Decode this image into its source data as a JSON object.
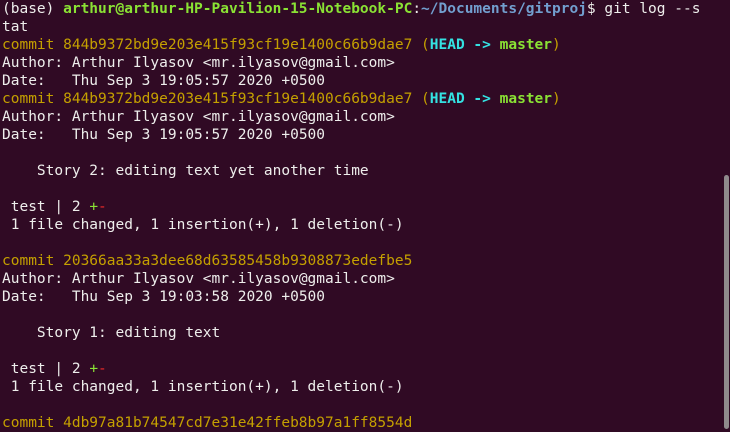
{
  "prompt": {
    "env": "(base) ",
    "user_host": "arthur@arthur-HP-Pavilion-15-Notebook-PC",
    "colon": ":",
    "path": "~/Documents/gitproj",
    "symbol": "$ ",
    "command_part1": "git log --s",
    "command_part2": "tat"
  },
  "commits": [
    {
      "prefix": "commit ",
      "hash": "844b9372bd9e203e415f93cf19e1400c66b9dae7",
      "ref_open": " (",
      "head": "HEAD -> ",
      "branch": "master",
      "ref_close": ")",
      "author_label": "Author: ",
      "author": "Arthur Ilyasov <mr.ilyasov@gmail.com>",
      "date_label": "Date:   ",
      "date": "Thu Sep 3 19:05:57 2020 +0500"
    },
    {
      "prefix": "commit ",
      "hash": "844b9372bd9e203e415f93cf19e1400c66b9dae7",
      "ref_open": " (",
      "head": "HEAD -> ",
      "branch": "master",
      "ref_close": ")",
      "author_label": "Author: ",
      "author": "Arthur Ilyasov <mr.ilyasov@gmail.com>",
      "date_label": "Date:   ",
      "date": "Thu Sep 3 19:05:57 2020 +0500",
      "message": "    Story 2: editing text yet another time",
      "stat_file": " test | 2 ",
      "stat_plus": "+",
      "stat_minus": "-",
      "summary": " 1 file changed, 1 insertion(+), 1 deletion(-)"
    },
    {
      "prefix": "commit ",
      "hash": "20366aa33a3dee68d63585458b9308873edefbe5",
      "author_label": "Author: ",
      "author": "Arthur Ilyasov <mr.ilyasov@gmail.com>",
      "date_label": "Date:   ",
      "date": "Thu Sep 3 19:03:58 2020 +0500",
      "message": "    Story 1: editing text",
      "stat_file": " test | 2 ",
      "stat_plus": "+",
      "stat_minus": "-",
      "summary": " 1 file changed, 1 insertion(+), 1 deletion(-)"
    },
    {
      "prefix": "commit ",
      "hash": "4db97a81b74547cd7e31e42ffeb8b97a1ff8554d"
    }
  ],
  "colors": {
    "background": "#300a24",
    "text": "#eeeeec",
    "prompt_user": "#8ae234",
    "prompt_path": "#729fcf",
    "commit_hash": "#c4a000",
    "head_ref": "#34e2e2",
    "branch": "#8ae234",
    "plus": "#8ae234",
    "minus": "#ef2929"
  }
}
